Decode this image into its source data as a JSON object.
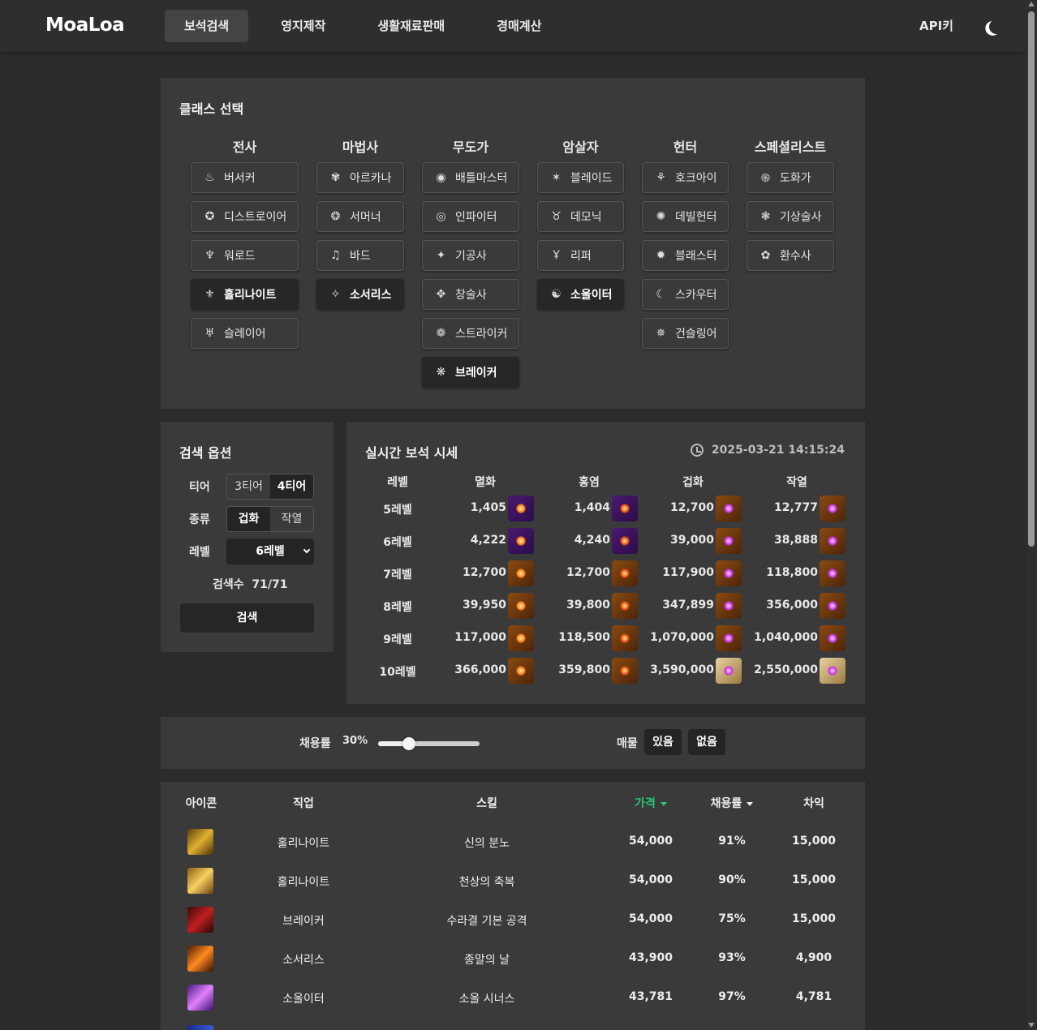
{
  "header": {
    "logo": "MoaLoa",
    "nav": [
      "보석검색",
      "영지제작",
      "생활재료판매",
      "경매계산"
    ],
    "api_key": "API키"
  },
  "class_select": {
    "title": "클래스 선택",
    "columns": [
      {
        "name": "전사",
        "classes": [
          "버서커",
          "디스트로이어",
          "워로드",
          "홀리나이트",
          "슬레이어"
        ],
        "selected": [
          "홀리나이트"
        ]
      },
      {
        "name": "마법사",
        "classes": [
          "아르카나",
          "서머너",
          "바드",
          "소서리스"
        ],
        "selected": [
          "소서리스"
        ]
      },
      {
        "name": "무도가",
        "classes": [
          "배틀마스터",
          "인파이터",
          "기공사",
          "창술사",
          "스트라이커",
          "브레이커"
        ],
        "selected": [
          "브레이커"
        ]
      },
      {
        "name": "암살자",
        "classes": [
          "블레이드",
          "데모닉",
          "리퍼",
          "소울이터"
        ],
        "selected": [
          "소울이터"
        ]
      },
      {
        "name": "헌터",
        "classes": [
          "호크아이",
          "데빌헌터",
          "블래스터",
          "스카우터",
          "건슬링어"
        ],
        "selected": []
      },
      {
        "name": "스페셜리스트",
        "classes": [
          "도화가",
          "기상술사",
          "환수사"
        ],
        "selected": []
      }
    ]
  },
  "search_options": {
    "title": "검색 옵션",
    "tier_label": "티어",
    "tiers": [
      "3티어",
      "4티어"
    ],
    "tier_selected": "4티어",
    "type_label": "종류",
    "types": [
      "겁화",
      "작열"
    ],
    "type_selected": "겁화",
    "level_label": "레벨",
    "level_value": "6레벨",
    "count_label": "검색수",
    "count_value": "71/71",
    "search_button": "검색"
  },
  "realtime": {
    "title": "실시간 보석 시세",
    "timestamp": "2025-03-21 14:15:24",
    "headers": [
      "레벨",
      "멸화",
      "홍염",
      "겁화",
      "작열"
    ],
    "rows": [
      {
        "level": "5레벨",
        "prices": [
          "1,405",
          "1,404",
          "12,700",
          "12,777"
        ]
      },
      {
        "level": "6레벨",
        "prices": [
          "4,222",
          "4,240",
          "39,000",
          "38,888"
        ]
      },
      {
        "level": "7레벨",
        "prices": [
          "12,700",
          "12,700",
          "117,900",
          "118,800"
        ]
      },
      {
        "level": "8레벨",
        "prices": [
          "39,950",
          "39,800",
          "347,899",
          "356,000"
        ]
      },
      {
        "level": "9레벨",
        "prices": [
          "117,000",
          "118,500",
          "1,070,000",
          "1,040,000"
        ]
      },
      {
        "level": "10레벨",
        "prices": [
          "366,000",
          "359,800",
          "3,590,000",
          "2,550,000"
        ]
      }
    ]
  },
  "filter": {
    "usage_label": "채용률",
    "usage_value": "30%",
    "usage_fraction": 0.3,
    "stock_label": "매물",
    "stock_yes": "있음",
    "stock_no": "없음"
  },
  "results": {
    "headers": {
      "icon": "아이콘",
      "job": "직업",
      "skill": "스킬",
      "price": "가격",
      "usage": "채용률",
      "diff": "차익"
    },
    "accent_color": "#28c76f",
    "rows": [
      {
        "job": "홀리나이트",
        "skill": "신의 분노",
        "price": "54,000",
        "usage": "91%",
        "diff": "15,000",
        "icon": "holy-sword-icon"
      },
      {
        "job": "홀리나이트",
        "skill": "천상의 축복",
        "price": "54,000",
        "usage": "90%",
        "diff": "15,000",
        "icon": "holy-wings-icon"
      },
      {
        "job": "브레이커",
        "skill": "수라결 기본 공격",
        "price": "54,000",
        "usage": "75%",
        "diff": "15,000",
        "icon": "red-fighter-icon"
      },
      {
        "job": "소서리스",
        "skill": "종말의 날",
        "price": "43,900",
        "usage": "93%",
        "diff": "4,900",
        "icon": "fire-meteor-icon"
      },
      {
        "job": "소울이터",
        "skill": "소울 시너스",
        "price": "43,781",
        "usage": "97%",
        "diff": "4,781",
        "icon": "purple-moon-icon"
      }
    ]
  }
}
